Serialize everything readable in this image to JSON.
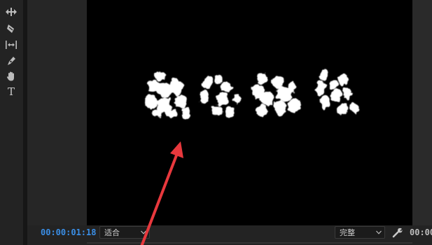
{
  "tools": [
    {
      "name": "track-select-icon"
    },
    {
      "name": "razor-icon"
    },
    {
      "name": "slip-icon"
    },
    {
      "name": "pen-icon"
    },
    {
      "name": "hand-icon"
    },
    {
      "name": "type-tool-icon",
      "label": "T"
    }
  ],
  "monitor": {
    "timecode": "00:00:01:18",
    "fit_label": "适合",
    "quality_label": "完整",
    "end_timecode": "00:00"
  },
  "colors": {
    "accent": "#3a8ee6",
    "arrow": "#e8383d",
    "viewer_bg": "#000000"
  },
  "annotation": {
    "type": "red-arrow"
  }
}
